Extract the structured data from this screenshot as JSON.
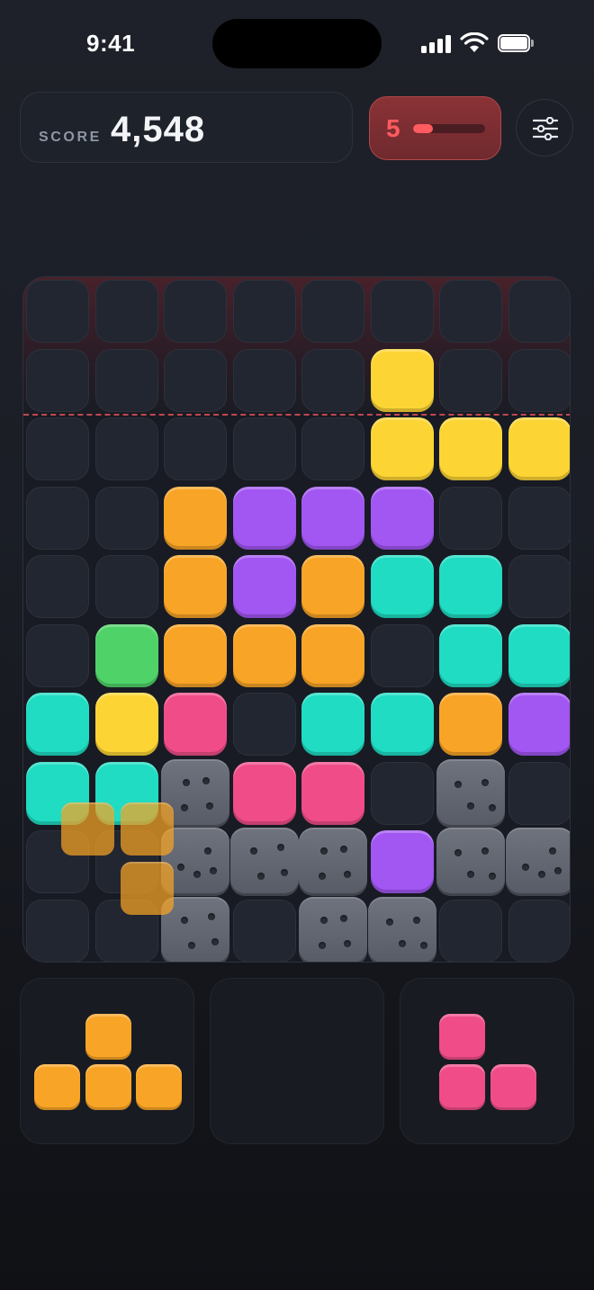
{
  "status_bar": {
    "time": "9:41"
  },
  "header": {
    "score_label": "SCORE",
    "score_value": "4,548",
    "level": "5",
    "level_progress": 0.28
  },
  "colors": {
    "yellow": "#fcd535",
    "orange": "#f8a426",
    "purple": "#a256f2",
    "teal": "#1fdcc3",
    "green": "#4fd368",
    "pink": "#f04d88",
    "stone": "#666a75",
    "danger": "#c0484e"
  },
  "board": {
    "columns": 8,
    "rows": 10,
    "danger_rows": 2,
    "grid": [
      [
        ".",
        ".",
        ".",
        ".",
        ".",
        ".",
        ".",
        "."
      ],
      [
        ".",
        ".",
        ".",
        ".",
        ".",
        "Y",
        ".",
        "."
      ],
      [
        ".",
        ".",
        ".",
        ".",
        ".",
        "Y",
        "Y",
        "Y"
      ],
      [
        ".",
        ".",
        "O",
        "P",
        "P",
        "P",
        ".",
        "."
      ],
      [
        ".",
        ".",
        "O",
        "P",
        "O",
        "T",
        "T",
        "."
      ],
      [
        ".",
        "G",
        "O",
        "O",
        "O",
        ".",
        "T",
        "T"
      ],
      [
        "T",
        "Y",
        "K",
        ".",
        "T",
        "T",
        "O",
        "P"
      ],
      [
        "T",
        "T",
        "S",
        "K",
        "K",
        ".",
        "S",
        "."
      ],
      [
        ".",
        ".",
        "S",
        "S",
        "S",
        "P",
        "S",
        "S"
      ],
      [
        ".",
        ".",
        "S",
        ".",
        "S",
        "S",
        ".",
        "."
      ]
    ]
  },
  "dragging_piece": {
    "color": "orange",
    "cells": [
      [
        0,
        0
      ],
      [
        0,
        1
      ],
      [
        1,
        1
      ]
    ]
  },
  "tray": {
    "slots": [
      {
        "color": "orange",
        "cells": [
          [
            0,
            1
          ],
          [
            1,
            0
          ],
          [
            1,
            1
          ],
          [
            1,
            2
          ]
        ]
      },
      {
        "color": "",
        "cells": []
      },
      {
        "color": "pink",
        "cells": [
          [
            0,
            0
          ],
          [
            1,
            0
          ],
          [
            1,
            1
          ]
        ]
      }
    ]
  }
}
